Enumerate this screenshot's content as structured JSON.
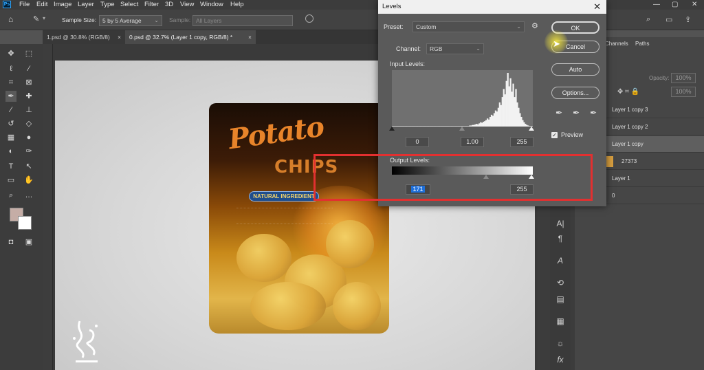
{
  "menubar": {
    "logo": "Ps",
    "items": [
      "File",
      "Edit",
      "Image",
      "Layer",
      "Type",
      "Select",
      "Filter",
      "3D",
      "View",
      "Window",
      "Help"
    ],
    "window_controls": [
      "—",
      "▢",
      "✕"
    ]
  },
  "options": {
    "sample_size_label": "Sample Size:",
    "sample_size_value": "5 by 5 Average",
    "sample_label": "Sample:",
    "sample_value": "All Layers"
  },
  "tabs": [
    {
      "label": "1.psd @ 30.8% (RGB/8)",
      "close": "×"
    },
    {
      "label": "0.psd @ 32.7% (Layer 1 copy, RGB/8) *",
      "close": "×"
    }
  ],
  "bag": {
    "title_line1": "Potato",
    "title_line2": "CHIPS",
    "badge": "NATURAL INGREDIENT"
  },
  "layers_panel": {
    "tabs": [
      "Channels",
      "Paths"
    ],
    "opacity_label": "Opacity:",
    "opacity_value": "100%",
    "fill_value": "100%",
    "rows": [
      {
        "name": "Layer 1 copy 3",
        "selected": false
      },
      {
        "name": "Layer 1 copy 2",
        "selected": false
      },
      {
        "name": "Layer 1 copy",
        "selected": true
      },
      {
        "name": "27373",
        "selected": false
      },
      {
        "name": "Layer 1",
        "selected": false
      },
      {
        "name": "0",
        "selected": false
      }
    ]
  },
  "levels": {
    "title": "Levels",
    "close": "✕",
    "preset_label": "Preset:",
    "preset_value": "Custom",
    "channel_label": "Channel:",
    "channel_value": "RGB",
    "input_label": "Input Levels:",
    "input_black": "0",
    "input_gamma": "1.00",
    "input_white": "255",
    "output_label": "Output Levels:",
    "output_black": "171",
    "output_white": "255",
    "buttons": {
      "ok": "OK",
      "cancel": "Cancel",
      "auto": "Auto",
      "options": "Options..."
    },
    "preview_label": "Preview",
    "preview_checked": true,
    "histogram": [
      1,
      1,
      1,
      1,
      1,
      1,
      1,
      1,
      1,
      1,
      1,
      1,
      1,
      1,
      1,
      1,
      1,
      1,
      1,
      1,
      1,
      1,
      1,
      1,
      1,
      1,
      1,
      1,
      1,
      1,
      1,
      1,
      1,
      1,
      1,
      1,
      1,
      1,
      1,
      1,
      1,
      1,
      1,
      1,
      1,
      1,
      1,
      1,
      1,
      1,
      1,
      1,
      1,
      1,
      1,
      1,
      1,
      2,
      2,
      3,
      3,
      4,
      5,
      4,
      6,
      8,
      7,
      9,
      10,
      12,
      15,
      13,
      18,
      22,
      20,
      25,
      30,
      28,
      35,
      45,
      40,
      55,
      70,
      60,
      85,
      100,
      75,
      90,
      65,
      80,
      55,
      70,
      45,
      35,
      25,
      18,
      12,
      8,
      5,
      3,
      2,
      1,
      1,
      1
    ]
  },
  "colors": {
    "highlight_red": "#e23030",
    "dialog_bg": "#5a5a5a",
    "panel_bg": "#3c3c3c",
    "selection_blue": "#1e6fd9"
  }
}
